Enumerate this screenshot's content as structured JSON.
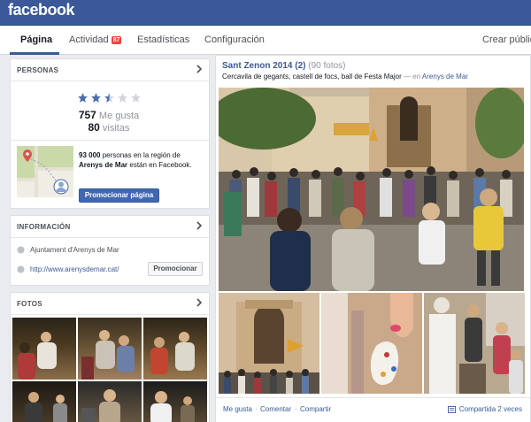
{
  "brand": "facebook",
  "tabs": [
    {
      "label": "Página"
    },
    {
      "label": "Actividad",
      "badge": "87"
    },
    {
      "label": "Estadísticas"
    },
    {
      "label": "Configuración"
    }
  ],
  "create_public": "Crear público",
  "people": {
    "header": "PERSONAS",
    "rating": 2.5,
    "likes_count": "757",
    "likes_label": "Me gusta",
    "visits_count": "80",
    "visits_label": "visitas",
    "region_count": "93 000",
    "region_text_1": "personas en la región de",
    "region_name": "Arenys de Mar",
    "region_text_2": "están en Facebook.",
    "promote_page": "Promocionar página"
  },
  "info": {
    "header": "INFORMACIÓN",
    "organization": "Ajuntament d'Arenys de Mar",
    "website": "http://www.arenysdemar.cat/",
    "promote": "Promocionar"
  },
  "photos": {
    "header": "FOTOS"
  },
  "post": {
    "album_title": "Sant Zenon 2014",
    "count_paren": "(2)",
    "photo_count": "(90 fotos)",
    "description": "Cercavila de gegants, castell de focs, ball de Festa Major",
    "dash_in": "— en",
    "location": "Arenys de Mar",
    "like": "Me gusta",
    "comment": "Comentar",
    "share": "Compartir",
    "shared": "Compartida 2 veces"
  },
  "colors": {
    "brand_blue": "#3b5998",
    "badge_red": "#fa3e3e",
    "star_filled": "#4a6ea9",
    "star_empty": "#d1d5db"
  }
}
